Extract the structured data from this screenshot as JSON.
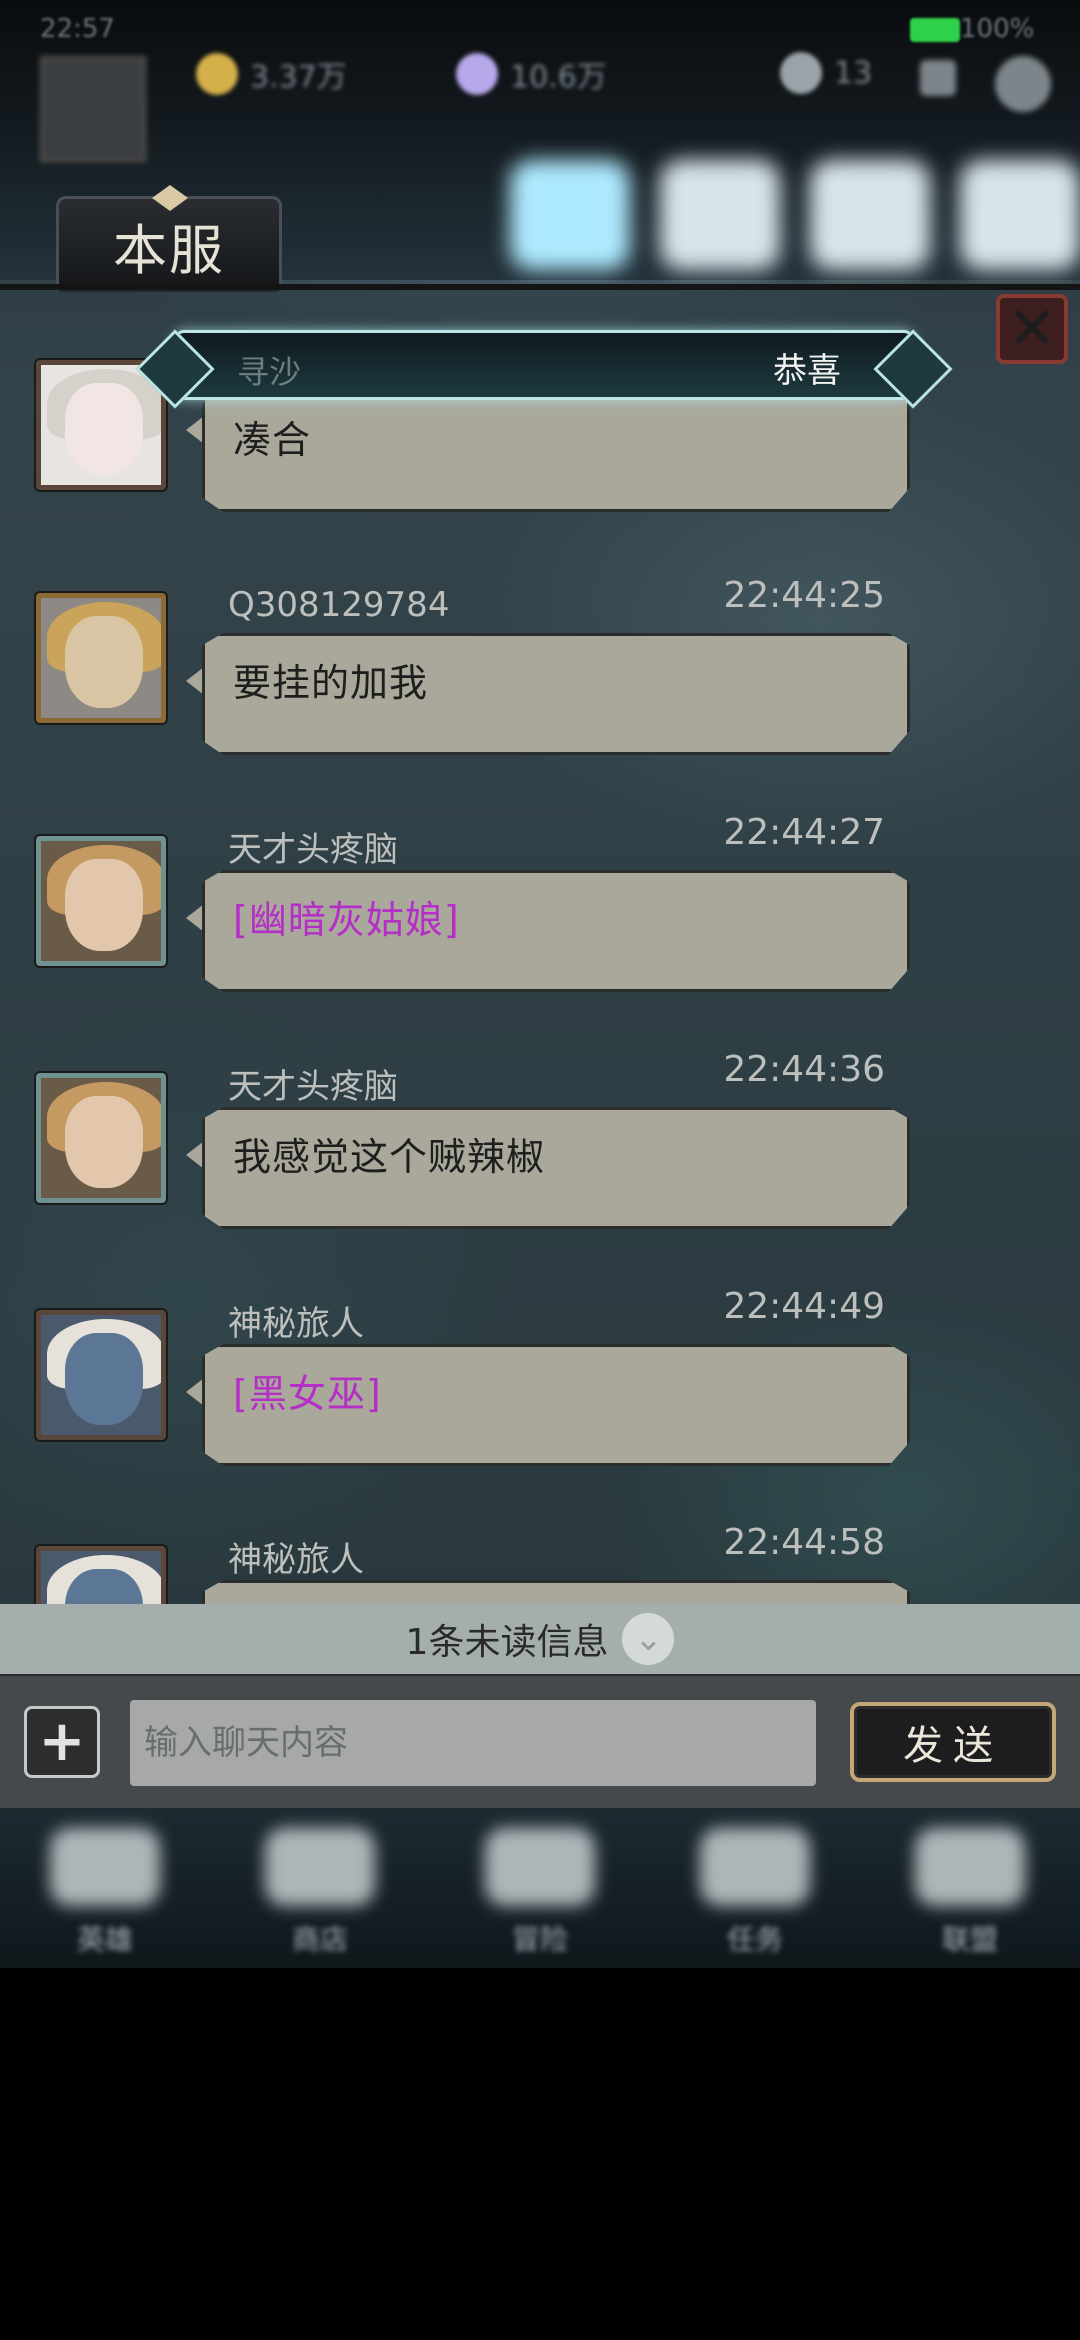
{
  "top_bar": {
    "time": "22:57",
    "battery": "100%",
    "resources": [
      {
        "name": "gold",
        "value": "3.37万",
        "color": "#d6b04a"
      },
      {
        "name": "gem",
        "value": "10.6万",
        "color": "#b7a8ea"
      },
      {
        "name": "stamina",
        "value": "13",
        "color": "#9aa3a8"
      }
    ]
  },
  "server_tab": {
    "label": "本服"
  },
  "congrats": {
    "sender": "寻沙",
    "text": "恭喜"
  },
  "messages": [
    {
      "sender": "寻沙",
      "time": "",
      "text": "凑合",
      "emote": false
    },
    {
      "sender": "Q308129784",
      "time": "22:44:25",
      "text": "要挂的加我",
      "emote": false
    },
    {
      "sender": "天才头疼脑",
      "time": "22:44:27",
      "text": "[幽暗灰姑娘]",
      "emote": true
    },
    {
      "sender": "天才头疼脑",
      "time": "22:44:36",
      "text": "我感觉这个贼辣椒",
      "emote": false
    },
    {
      "sender": "神秘旅人",
      "time": "22:44:49",
      "text": "[黑女巫]",
      "emote": true
    },
    {
      "sender": "神秘旅人",
      "time": "22:44:58",
      "text": "",
      "emote": false
    }
  ],
  "unread": {
    "text": "1条未读信息"
  },
  "input": {
    "placeholder": "输入聊天内容",
    "value": ""
  },
  "send_button": {
    "label": "发送"
  },
  "bottom_nav": [
    "英雄",
    "商店",
    "冒险",
    "任务",
    "联盟"
  ]
}
